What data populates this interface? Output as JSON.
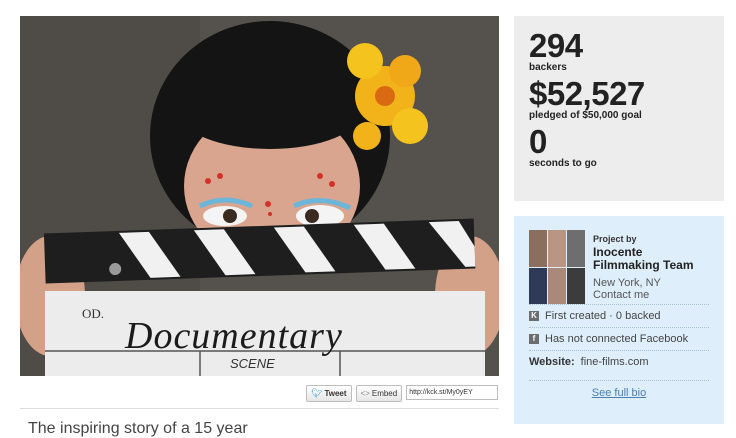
{
  "stats": {
    "backers_count": "294",
    "backers_label": "backers",
    "pledged_amount": "$52,527",
    "pledged_label": "pledged of $50,000 goal",
    "time_value": "0",
    "time_label": "seconds to go"
  },
  "share": {
    "tweet_label": "Tweet",
    "embed_label": "Embed",
    "short_url": "http://kck.st/My0yEY"
  },
  "clapperboard": {
    "title": "Documentary",
    "prod_label": "OD.",
    "scene_label": "SCENE"
  },
  "blurb": {
    "text": "The inspiring story of a 15 year"
  },
  "creator": {
    "project_by_label": "Project by",
    "name": "Inocente Filmmaking Team",
    "location": "New York, NY",
    "contact_label": "Contact me",
    "history": "First created · 0 backed",
    "facebook": "Has not connected Facebook",
    "website_label": "Website:",
    "website": "fine-films.com",
    "bio_link": "See full bio"
  },
  "colors": {
    "stats_bg": "#ededed",
    "creator_bg": "#dfeefb",
    "link": "#4a7db0"
  }
}
